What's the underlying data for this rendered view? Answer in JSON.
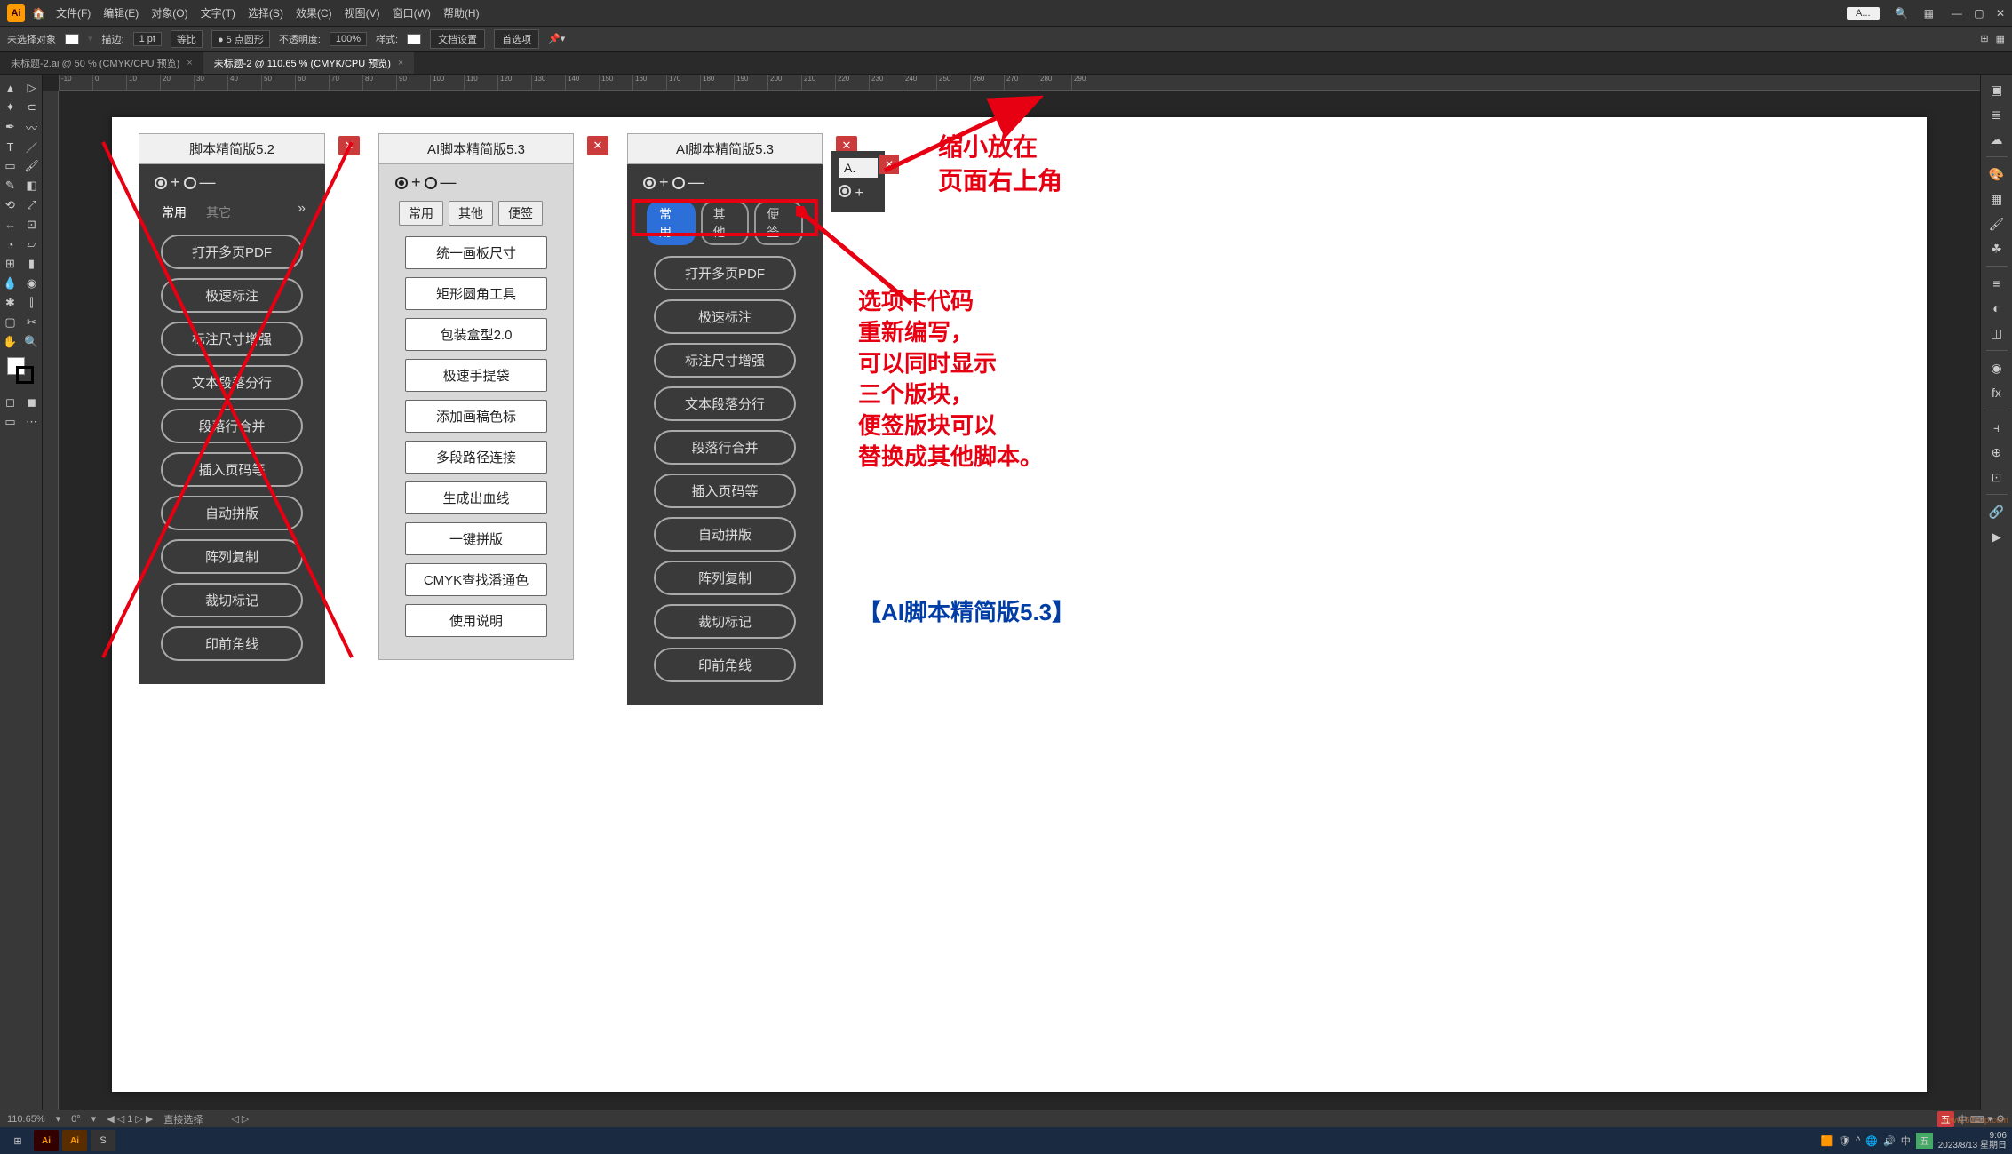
{
  "menubar": {
    "items": [
      "文件(F)",
      "编辑(E)",
      "对象(O)",
      "文字(T)",
      "选择(S)",
      "效果(C)",
      "视图(V)",
      "窗口(W)",
      "帮助(H)"
    ],
    "floating_label": "A..."
  },
  "controlbar": {
    "no_selection": "未选择对象",
    "stroke_label": "描边:",
    "stroke_value": "1 pt",
    "uniform": "等比",
    "point_round": "5 点圆形",
    "opacity_label": "不透明度:",
    "opacity_value": "100%",
    "style_label": "样式:",
    "doc_setup": "文档设置",
    "prefs": "首选项"
  },
  "tabs": [
    {
      "label": "未标题-2.ai @ 50 % (CMYK/CPU 预览)",
      "active": false
    },
    {
      "label": "未标题-2 @ 110.65 % (CMYK/CPU 预览)",
      "active": true
    }
  ],
  "ruler_ticks": [
    "-10",
    "0",
    "10",
    "20",
    "30",
    "40",
    "50",
    "60",
    "70",
    "80",
    "90",
    "100",
    "110",
    "120",
    "130",
    "140",
    "150",
    "160",
    "170",
    "180",
    "190",
    "200",
    "210",
    "220",
    "230",
    "240",
    "250",
    "260",
    "270",
    "280",
    "290"
  ],
  "panels": {
    "p52": {
      "title": "脚本精简版5.2",
      "tabs": [
        "常用",
        "其它"
      ],
      "buttons": [
        "打开多页PDF",
        "极速标注",
        "标注尺寸增强",
        "文本段落分行",
        "段落行合并",
        "插入页码等",
        "自动拼版",
        "阵列复制",
        "裁切标记",
        "印前角线"
      ]
    },
    "p53light": {
      "title": "AI脚本精简版5.3",
      "tabs": [
        "常用",
        "其他",
        "便签"
      ],
      "buttons": [
        "统一画板尺寸",
        "矩形圆角工具",
        "包装盒型2.0",
        "极速手提袋",
        "添加画稿色标",
        "多段路径连接",
        "生成出血线",
        "一键拼版",
        "CMYK查找潘通色",
        "使用说明"
      ]
    },
    "p53dark": {
      "title": "AI脚本精简版5.3",
      "tabs": [
        "常用",
        "其他",
        "便签"
      ],
      "buttons": [
        "打开多页PDF",
        "极速标注",
        "标注尺寸增强",
        "文本段落分行",
        "段落行合并",
        "插入页码等",
        "自动拼版",
        "阵列复制",
        "裁切标记",
        "印前角线"
      ]
    },
    "mini": {
      "title": "A."
    }
  },
  "annotations": {
    "top": "缩小放在\n页面右上角",
    "mid": "选项卡代码\n重新编写，\n可以同时显示\n三个版块，\n便签版块可以\n替换成其他脚本。",
    "bottom": "【AI脚本精简版5.3】"
  },
  "statusbar": {
    "zoom": "110.65%",
    "rotate": "0°",
    "artboard": "1",
    "tool": "直接选择"
  },
  "taskbar": {
    "time": "9:06",
    "date": "2023/8/13 星期日"
  },
  "tray_indicator": "五",
  "watermark": "www.52cnp.com"
}
